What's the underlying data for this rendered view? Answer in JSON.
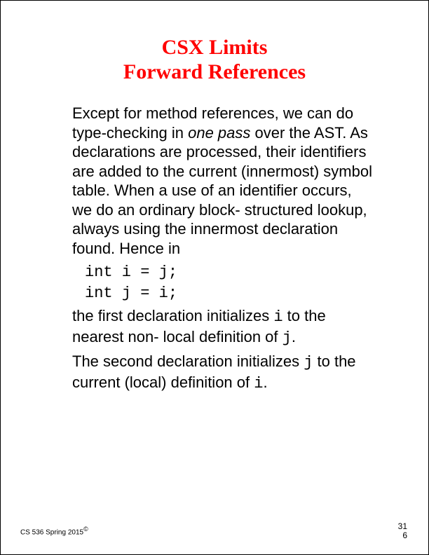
{
  "title_line1": "CSX Limits",
  "title_line2": "Forward References",
  "para1_a": "Except for method references, we can do type-checking in ",
  "para1_em": "one pass",
  "para1_b": " over the AST. As declarations are processed, their identifiers are added to the current (innermost) symbol table. When a use of an identifier occurs, we do an ordinary block- structured lookup, always using the innermost declaration found. Hence in",
  "code1": "int i = j;",
  "code2": "int j = i;",
  "para2_a": "the first declaration initializes ",
  "para2_code1": "i",
  "para2_b": " to the nearest non- local definition of ",
  "para2_code2": "j",
  "para2_c": ".",
  "para3_a": "The second declaration initializes ",
  "para3_code1": "j",
  "para3_b": " to the current (local) definition of ",
  "para3_code2": "i",
  "para3_c": ".",
  "footer_course": "CS 536  Spring 2015",
  "footer_copyright": "©",
  "footer_page1": "31",
  "footer_page2": "6"
}
